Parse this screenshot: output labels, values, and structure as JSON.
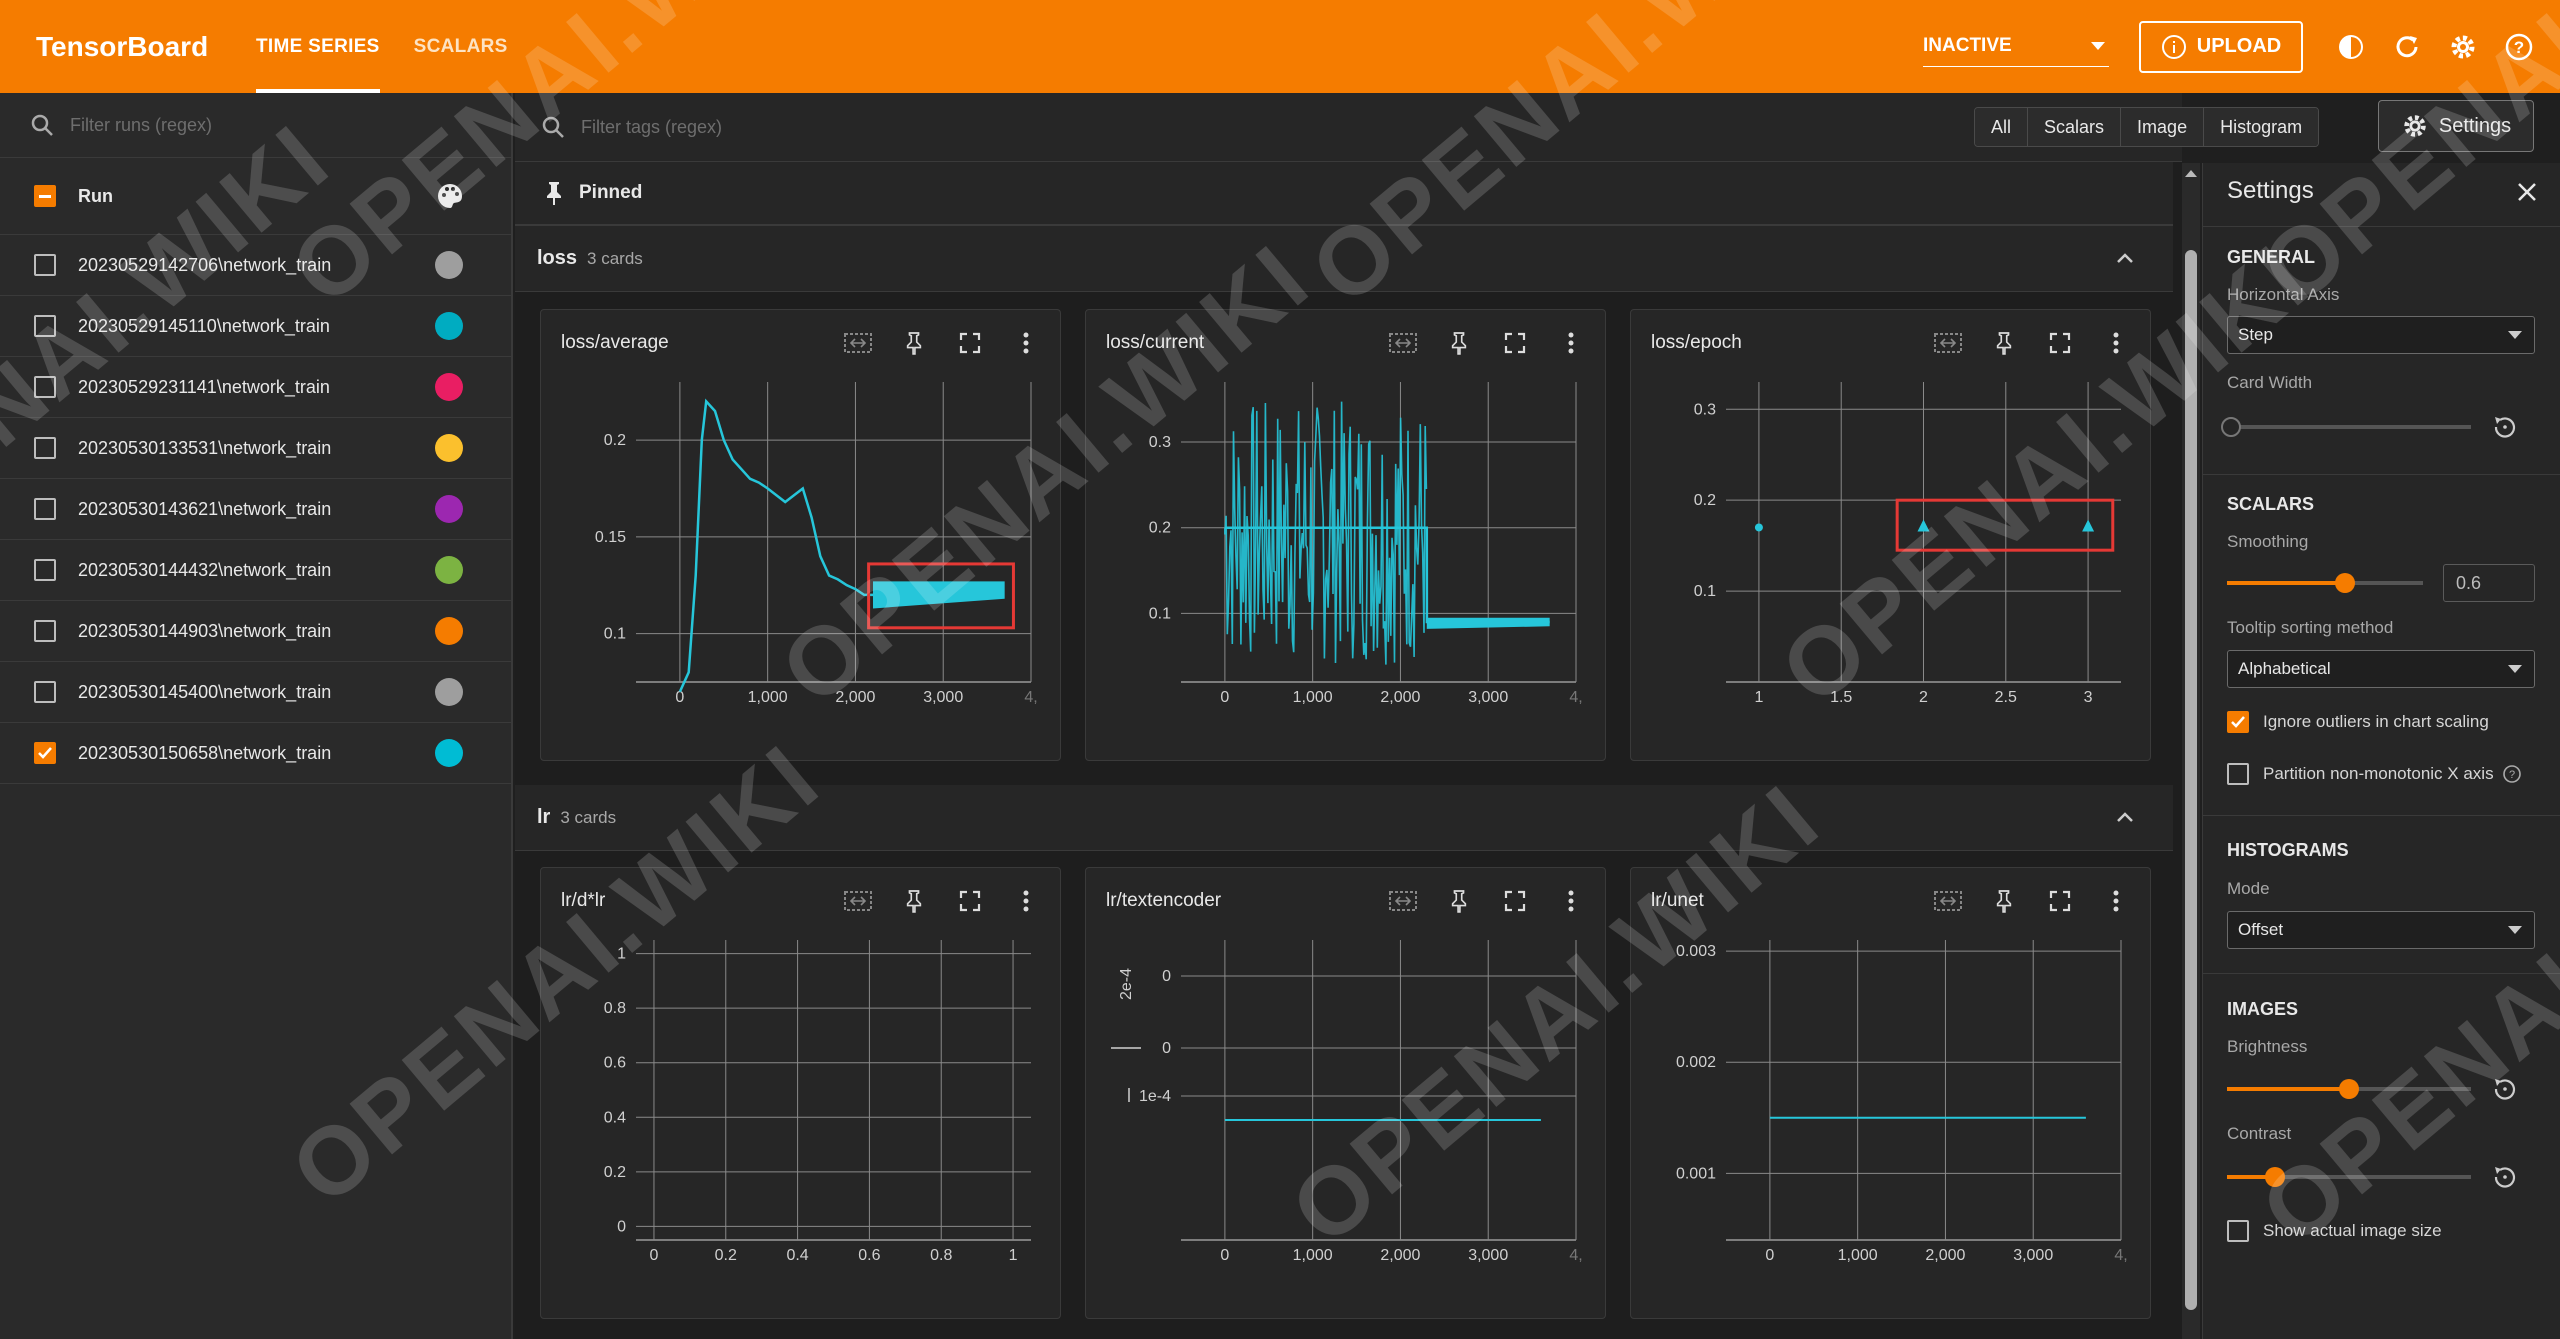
{
  "app": {
    "brand": "TensorBoard",
    "tabs": [
      "TIME SERIES",
      "SCALARS"
    ],
    "status": "INACTIVE",
    "upload": "UPLOAD"
  },
  "sidebar": {
    "search_placeholder": "Filter runs (regex)",
    "header": "Run",
    "runs": [
      {
        "name": "20230529142706\\network_train",
        "color": "#9e9e9e",
        "checked": false
      },
      {
        "name": "20230529145110\\network_train",
        "color": "#00acc1",
        "checked": false
      },
      {
        "name": "20230529231141\\network_train",
        "color": "#e91e63",
        "checked": false
      },
      {
        "name": "20230530133531\\network_train",
        "color": "#fbc02d",
        "checked": false
      },
      {
        "name": "20230530143621\\network_train",
        "color": "#9c27b0",
        "checked": false
      },
      {
        "name": "20230530144432\\network_train",
        "color": "#7cb342",
        "checked": false
      },
      {
        "name": "20230530144903\\network_train",
        "color": "#f57c00",
        "checked": false
      },
      {
        "name": "20230530145400\\network_train",
        "color": "#9e9e9e",
        "checked": false
      },
      {
        "name": "20230530150658\\network_train",
        "color": "#00bcd4",
        "checked": true
      }
    ]
  },
  "main": {
    "tag_filter_placeholder": "Filter tags (regex)",
    "type_filters": [
      "All",
      "Scalars",
      "Image",
      "Histogram"
    ],
    "settings_button": "Settings",
    "pinned_label": "Pinned",
    "groups": [
      {
        "name": "loss",
        "count": "3 cards"
      },
      {
        "name": "lr",
        "count": "3 cards"
      }
    ]
  },
  "cards": [
    {
      "title": "loss/average",
      "xticks": [
        "0",
        "1,000",
        "2,000",
        "3,000",
        "4,"
      ],
      "yticks": [
        "0.2",
        "0.15",
        "0.1"
      ]
    },
    {
      "title": "loss/current",
      "xticks": [
        "0",
        "1,000",
        "2,000",
        "3,000",
        "4,"
      ],
      "yticks": [
        "0.3",
        "0.2",
        "0.1"
      ]
    },
    {
      "title": "loss/epoch",
      "xticks": [
        "1",
        "1.5",
        "2",
        "2.5",
        "3"
      ],
      "yticks": [
        "0.3",
        "0.2",
        "0.1"
      ]
    },
    {
      "title": "lr/d*lr",
      "xticks": [
        "0",
        "0.2",
        "0.4",
        "0.6",
        "0.8",
        "1"
      ],
      "yticks": [
        "1",
        "0.8",
        "0.6",
        "0.4",
        "0.2",
        "0"
      ]
    },
    {
      "title": "lr/textencoder",
      "xticks": [
        "0",
        "1,000",
        "2,000",
        "3,000",
        "4,"
      ],
      "yticks": [
        "0",
        "0",
        "1e-4"
      ],
      "yexp": "2e-4"
    },
    {
      "title": "lr/unet",
      "xticks": [
        "0",
        "1,000",
        "2,000",
        "3,000",
        "4,"
      ],
      "yticks": [
        "0.003",
        "0.002",
        "0.001"
      ]
    }
  ],
  "chart_data": [
    {
      "type": "line",
      "title": "loss/average",
      "series": [
        {
          "x": [
            0,
            100,
            180,
            250,
            300,
            400,
            500,
            600,
            700,
            800,
            900,
            1000,
            1200,
            1400,
            1500,
            1600,
            1700,
            1800,
            1900,
            2000,
            2100,
            2200,
            2500,
            2800,
            3300
          ],
          "values": [
            0.07,
            0.08,
            0.13,
            0.2,
            0.22,
            0.215,
            0.2,
            0.19,
            0.185,
            0.18,
            0.178,
            0.175,
            0.168,
            0.175,
            0.16,
            0.14,
            0.13,
            0.128,
            0.125,
            0.123,
            0.12,
            0.12,
            0.12,
            0.12,
            0.12
          ]
        }
      ],
      "ylim": [
        0.075,
        0.23
      ],
      "xlim": [
        -500,
        4000
      ]
    },
    {
      "type": "line",
      "title": "loss/current",
      "series": [
        {
          "x": [
            0,
            2300,
            2301,
            3700
          ],
          "values": [
            0.2,
            0.2,
            0.09,
            0.09
          ]
        }
      ],
      "ylim": [
        0.02,
        0.37
      ],
      "xlim": [
        -500,
        4000
      ]
    },
    {
      "type": "scatter",
      "title": "loss/epoch",
      "series": [
        {
          "x": [
            1,
            2,
            3
          ],
          "values": [
            0.17,
            0.17,
            0.17
          ]
        }
      ],
      "ylim": [
        0,
        0.33
      ],
      "xlim": [
        0.8,
        3.2
      ]
    },
    {
      "type": "line",
      "title": "lr/d*lr",
      "series": [],
      "ylim": [
        -0.05,
        1.05
      ],
      "xlim": [
        -0.05,
        1.05
      ]
    },
    {
      "type": "line",
      "title": "lr/textencoder",
      "series": [
        {
          "x": [
            0,
            3600
          ],
          "values": [
            0.0001,
            0.0001
          ]
        }
      ],
      "ylim": [
        0,
        0.00025
      ],
      "xlim": [
        -500,
        4000
      ]
    },
    {
      "type": "line",
      "title": "lr/unet",
      "series": [
        {
          "x": [
            0,
            3600
          ],
          "values": [
            0.0015,
            0.0015
          ]
        }
      ],
      "ylim": [
        0.0004,
        0.0031
      ],
      "xlim": [
        -500,
        4000
      ]
    }
  ],
  "settings": {
    "title": "Settings",
    "general": "GENERAL",
    "horizontal_axis_label": "Horizontal Axis",
    "horizontal_axis_value": "Step",
    "card_width_label": "Card Width",
    "card_width_level": 0,
    "scalars": "SCALARS",
    "smoothing_label": "Smoothing",
    "smoothing_value": "0.6",
    "tooltip_label": "Tooltip sorting method",
    "tooltip_value": "Alphabetical",
    "ignore_outliers": "Ignore outliers in chart scaling",
    "partition": "Partition non-monotonic X axis",
    "histograms": "HISTOGRAMS",
    "mode_label": "Mode",
    "mode_value": "Offset",
    "images": "IMAGES",
    "brightness_label": "Brightness",
    "brightness_level": 0.5,
    "contrast_label": "Contrast",
    "contrast_level": 0.2,
    "actual_size": "Show actual image size"
  },
  "watermark": "OPENAI.WIKI",
  "colors": {
    "accent": "#f57c00",
    "series": "#26c6da",
    "highlight": "#e53935"
  }
}
